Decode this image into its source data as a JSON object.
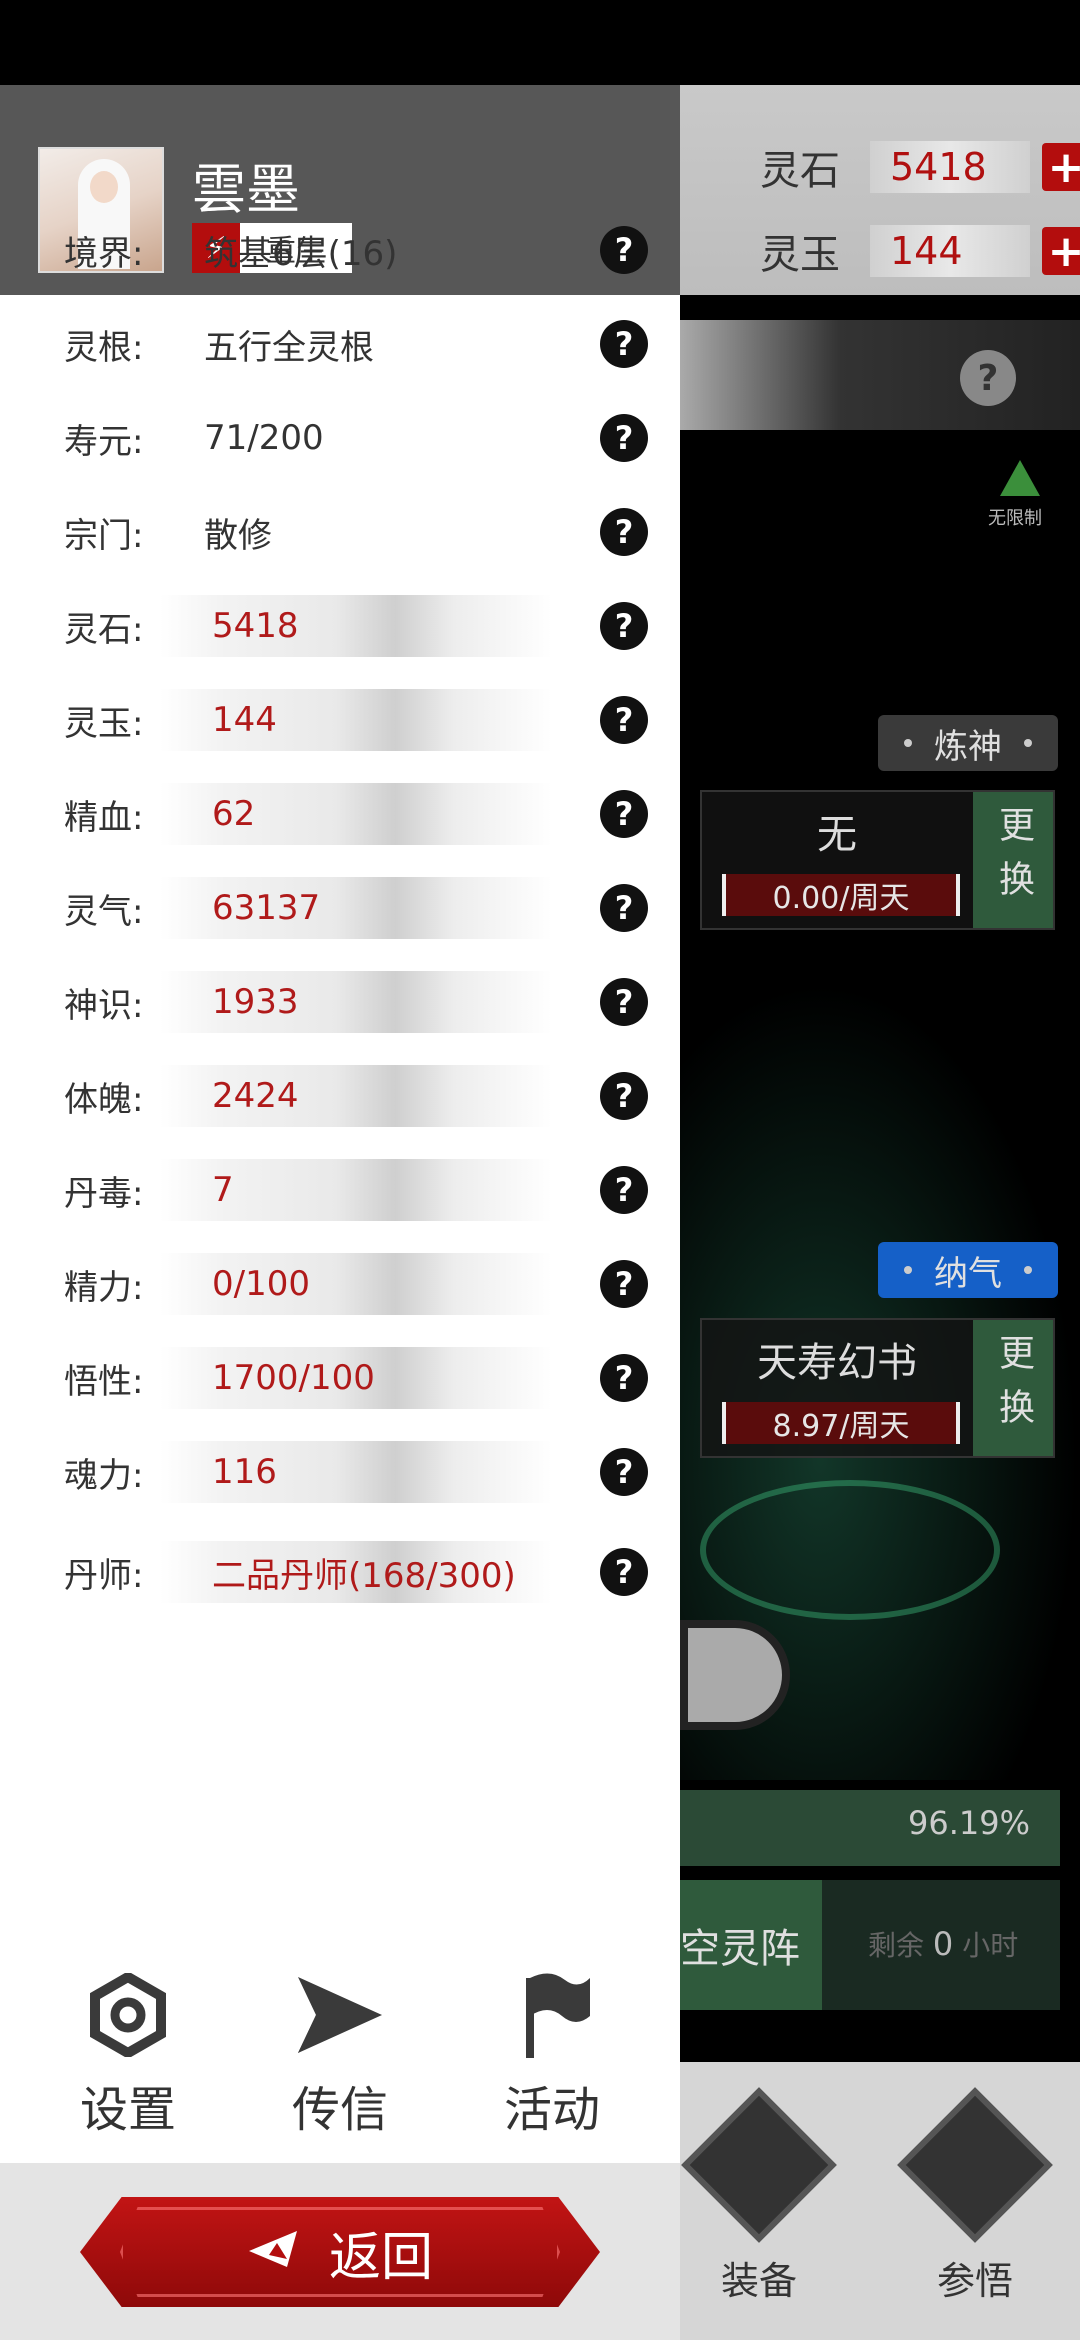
{
  "background": {
    "resources": [
      {
        "label": "灵石",
        "value": "5418"
      },
      {
        "label": "灵玉",
        "value": "144"
      }
    ],
    "unlimited_label": "无限制",
    "tags": {
      "refine": "炼神",
      "absorb": "纳气"
    },
    "slots": [
      {
        "name": "无",
        "rate": "0.00/周天",
        "change": "更换"
      },
      {
        "name": "天寿幻书",
        "rate": "8.97/周天",
        "change": "更换"
      }
    ],
    "progress": "96.19%",
    "array": {
      "label": "空灵阵",
      "remaining_prefix": "剩余",
      "remaining_value": "0",
      "remaining_suffix": "小时"
    },
    "bottom_nav": [
      {
        "label": "装备"
      },
      {
        "label": "参悟"
      }
    ]
  },
  "profile": {
    "name": "雲墨",
    "rebirth_label": "重生"
  },
  "stats": [
    {
      "label": "境界:",
      "value": "筑基6层(16)"
    },
    {
      "label": "灵根:",
      "value": "五行全灵根"
    },
    {
      "label": "寿元:",
      "value": "71/200"
    },
    {
      "label": "宗门:",
      "value": "散修"
    },
    {
      "label": "灵石:",
      "value": "5418"
    },
    {
      "label": "灵玉:",
      "value": "144"
    },
    {
      "label": "精血:",
      "value": "62"
    },
    {
      "label": "灵气:",
      "value": "63137"
    },
    {
      "label": "神识:",
      "value": "1933"
    },
    {
      "label": "体魄:",
      "value": "2424"
    },
    {
      "label": "丹毒:",
      "value": "7"
    },
    {
      "label": "精力:",
      "value": "0/100"
    },
    {
      "label": "悟性:",
      "value": "1700/100"
    },
    {
      "label": "魂力:",
      "value": "116"
    },
    {
      "label": "丹师:",
      "value": "二品丹师(168/300)"
    }
  ],
  "nav": [
    {
      "label": "设置",
      "icon": "gear-icon"
    },
    {
      "label": "传信",
      "icon": "send-icon"
    },
    {
      "label": "活动",
      "icon": "flag-icon"
    }
  ],
  "back_label": "返回",
  "colors": {
    "accent_red": "#b30d0d",
    "value_red": "#b01a1a",
    "green": "#2f5a3c",
    "blue_tag": "#1560c8"
  }
}
